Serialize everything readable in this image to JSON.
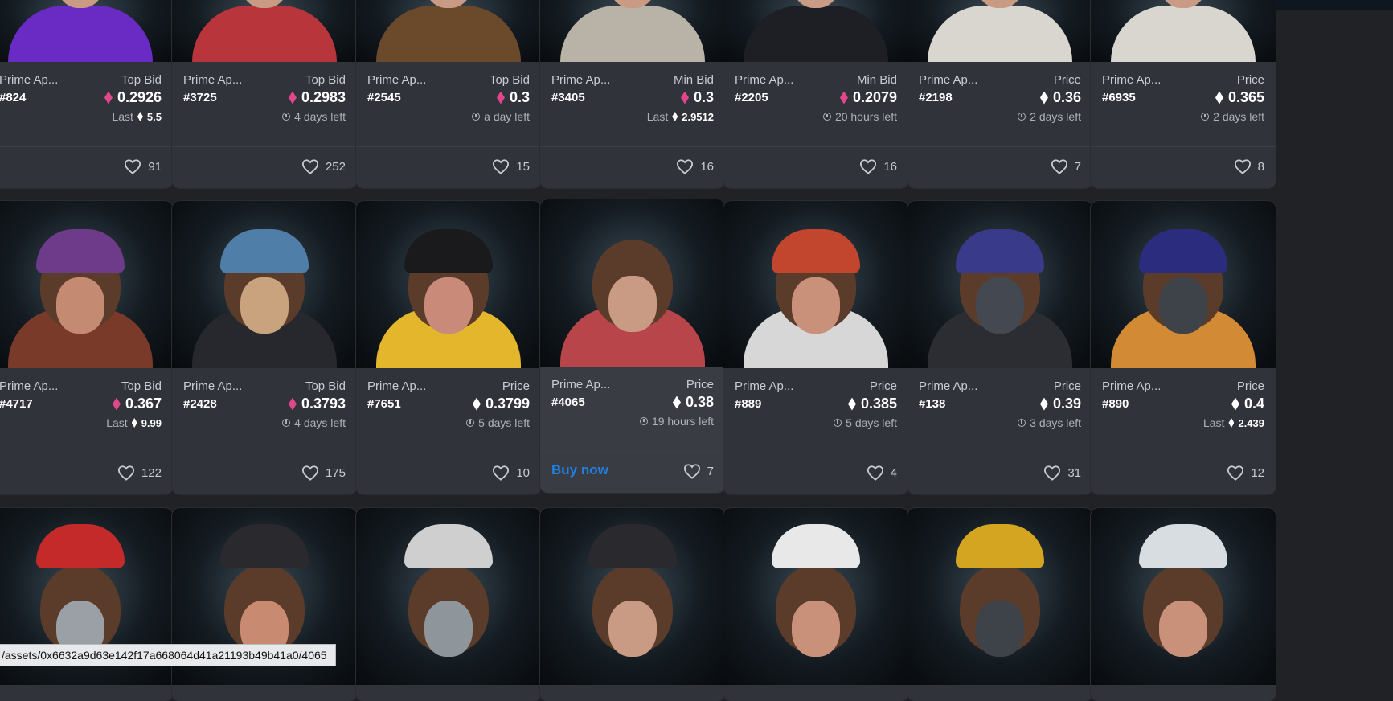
{
  "rows": [
    [
      {
        "collection": "Prime Ap...",
        "token": "#824",
        "price_label": "Top Bid",
        "price": "0.2926",
        "eth": "pink",
        "sub_type": "last",
        "sub_label": "Last",
        "sub_value": "5.5",
        "likes": "91",
        "hoodie": "#6a2bc4",
        "hat": ""
      },
      {
        "collection": "Prime Ap...",
        "token": "#3725",
        "price_label": "Top Bid",
        "price": "0.2983",
        "eth": "pink",
        "sub_type": "time",
        "sub_value": "4 days left",
        "likes": "252",
        "hoodie": "#b8353b",
        "hat": ""
      },
      {
        "collection": "Prime Ap...",
        "token": "#2545",
        "price_label": "Top Bid",
        "price": "0.3",
        "eth": "pink",
        "sub_type": "time",
        "sub_value": "a day left",
        "likes": "15",
        "hoodie": "#6b4a2c",
        "hat": ""
      },
      {
        "collection": "Prime Ap...",
        "token": "#3405",
        "price_label": "Min Bid",
        "price": "0.3",
        "eth": "pink",
        "sub_type": "last",
        "sub_label": "Last",
        "sub_value": "2.9512",
        "likes": "16",
        "hoodie": "#b9b2a6",
        "hat": ""
      },
      {
        "collection": "Prime Ap...",
        "token": "#2205",
        "price_label": "Min Bid",
        "price": "0.2079",
        "eth": "pink",
        "sub_type": "time",
        "sub_value": "20 hours left",
        "likes": "16",
        "hoodie": "#1d1f24",
        "hat": ""
      },
      {
        "collection": "Prime Ap...",
        "token": "#2198",
        "price_label": "Price",
        "price": "0.36",
        "eth": "white",
        "sub_type": "time",
        "sub_value": "2 days left",
        "likes": "7",
        "hoodie": "#d9d6d0",
        "hat": ""
      },
      {
        "collection": "Prime Ap...",
        "token": "#6935",
        "price_label": "Price",
        "price": "0.365",
        "eth": "white",
        "sub_type": "time",
        "sub_value": "2 days left",
        "likes": "8",
        "hoodie": "#d9d6d0",
        "hat": ""
      }
    ],
    [
      {
        "collection": "Prime Ap...",
        "token": "#4717",
        "price_label": "Top Bid",
        "price": "0.367",
        "eth": "pink",
        "sub_type": "last",
        "sub_label": "Last",
        "sub_value": "9.99",
        "likes": "122",
        "hoodie": "#7a3a2a",
        "hat": "#6e3a8a",
        "face": "#c48a72"
      },
      {
        "collection": "Prime Ap...",
        "token": "#2428",
        "price_label": "Top Bid",
        "price": "0.3793",
        "eth": "pink",
        "sub_type": "time",
        "sub_value": "4 days left",
        "likes": "175",
        "hoodie": "#26282e",
        "hat": "#4f7fa8",
        "face": "#c9a37e"
      },
      {
        "collection": "Prime Ap...",
        "token": "#7651",
        "price_label": "Price",
        "price": "0.3799",
        "eth": "white",
        "sub_type": "time",
        "sub_value": "5 days left",
        "likes": "10",
        "hoodie": "#e3b62b",
        "hat": "#1a1a1c",
        "face": "#c98a7a"
      },
      {
        "collection": "Prime Ap...",
        "token": "#4065",
        "price_label": "Price",
        "price": "0.38",
        "eth": "white",
        "sub_type": "time",
        "sub_value": "19 hours left",
        "likes": "7",
        "hoodie": "#b8454a",
        "hat": "",
        "face": "#c99a84",
        "buy": "Buy now"
      },
      {
        "collection": "Prime Ap...",
        "token": "#889",
        "price_label": "Price",
        "price": "0.385",
        "eth": "white",
        "sub_type": "time",
        "sub_value": "5 days left",
        "likes": "4",
        "hoodie": "#d7d7d7",
        "hat": "#c2452e",
        "face": "#c9907a"
      },
      {
        "collection": "Prime Ap...",
        "token": "#138",
        "price_label": "Price",
        "price": "0.39",
        "eth": "white",
        "sub_type": "time",
        "sub_value": "3 days left",
        "likes": "31",
        "hoodie": "#2b2d33",
        "hat": "#3a3a8a",
        "face": "#444850"
      },
      {
        "collection": "Prime Ap...",
        "token": "#890",
        "price_label": "Price",
        "price": "0.4",
        "eth": "white",
        "sub_type": "last",
        "sub_label": "Last",
        "sub_value": "2.439",
        "likes": "12",
        "hoodie": "#d28a34",
        "hat": "#2c2c7e",
        "face": "#3e4249"
      }
    ],
    [
      {
        "hat": "#c42a2a",
        "face": "#9aa0a6"
      },
      {
        "hat": "#2a2a2e",
        "face": "#c98a72"
      },
      {
        "hat": "#cfcfcf",
        "face": "#8e969c"
      },
      {
        "hat": "#2a2a2e",
        "face": "#c99a84"
      },
      {
        "hat": "#e8e8e8",
        "face": "#c9907a"
      },
      {
        "hat": "#d4a520",
        "face": "#3e4249"
      },
      {
        "hat": "#d8dde2",
        "face": "#c9907a"
      }
    ]
  ],
  "status_url": "/assets/0x6632a9d63e142f17a668064d41a21193b49b41a0/4065",
  "colors": {
    "accent": "#2081e2",
    "eth_pink": "#e2478d",
    "background": "#202226",
    "card": "#303339"
  }
}
